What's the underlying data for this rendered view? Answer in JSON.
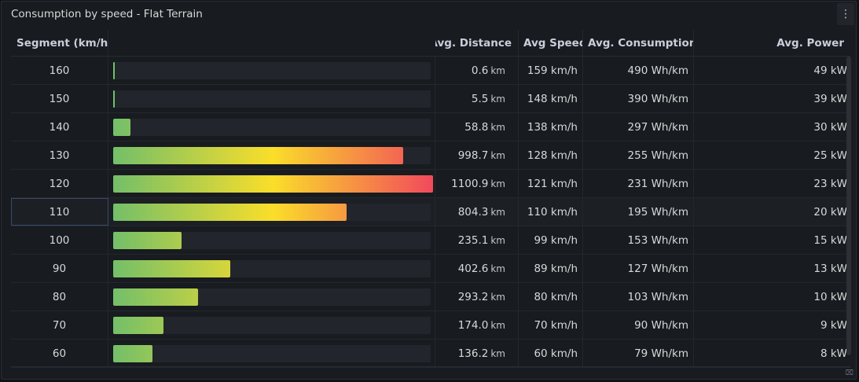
{
  "panel": {
    "title": "Consumption by speed - Flat Terrain",
    "menu_icon": "vertical-ellipsis-icon"
  },
  "columns": {
    "segment": "Segment (km/h)",
    "distance": "Avg. Distance",
    "speed": "Avg Speed",
    "consumption": "Avg. Consumption",
    "power": "Avg. Power"
  },
  "units": {
    "distance": "km"
  },
  "bar_colors": [
    "#73bf69",
    "#fade2a",
    "#f2495c"
  ],
  "bar_max_km": 1100.9,
  "rows": [
    {
      "segment": "160",
      "distance": "0.6",
      "distance_km": 0.6,
      "speed": "159 km/h",
      "consumption": "490 Wh/km",
      "power": "49 kW"
    },
    {
      "segment": "150",
      "distance": "5.5",
      "distance_km": 5.5,
      "speed": "148 km/h",
      "consumption": "390 Wh/km",
      "power": "39 kW"
    },
    {
      "segment": "140",
      "distance": "58.8",
      "distance_km": 58.8,
      "speed": "138 km/h",
      "consumption": "297 Wh/km",
      "power": "30 kW"
    },
    {
      "segment": "130",
      "distance": "998.7",
      "distance_km": 998.7,
      "speed": "128 km/h",
      "consumption": "255 Wh/km",
      "power": "25 kW"
    },
    {
      "segment": "120",
      "distance": "1100.9",
      "distance_km": 1100.9,
      "speed": "121 km/h",
      "consumption": "231 Wh/km",
      "power": "23 kW"
    },
    {
      "segment": "110",
      "distance": "804.3",
      "distance_km": 804.3,
      "speed": "110 km/h",
      "consumption": "195 Wh/km",
      "power": "20 kW"
    },
    {
      "segment": "100",
      "distance": "235.1",
      "distance_km": 235.1,
      "speed": "99 km/h",
      "consumption": "153 Wh/km",
      "power": "15 kW"
    },
    {
      "segment": "90",
      "distance": "402.6",
      "distance_km": 402.6,
      "speed": "89 km/h",
      "consumption": "127 Wh/km",
      "power": "13 kW"
    },
    {
      "segment": "80",
      "distance": "293.2",
      "distance_km": 293.2,
      "speed": "80 km/h",
      "consumption": "103 Wh/km",
      "power": "10 kW"
    },
    {
      "segment": "70",
      "distance": "174.0",
      "distance_km": 174.0,
      "speed": "70 km/h",
      "consumption": "90 Wh/km",
      "power": "9 kW"
    },
    {
      "segment": "60",
      "distance": "136.2",
      "distance_km": 136.2,
      "speed": "60 km/h",
      "consumption": "79 Wh/km",
      "power": "8 kW"
    }
  ]
}
